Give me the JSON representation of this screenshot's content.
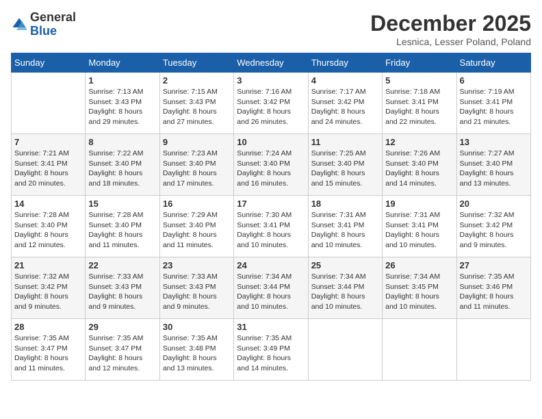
{
  "logo": {
    "general": "General",
    "blue": "Blue"
  },
  "header": {
    "month_title": "December 2025",
    "location": "Lesnica, Lesser Poland, Poland"
  },
  "days_of_week": [
    "Sunday",
    "Monday",
    "Tuesday",
    "Wednesday",
    "Thursday",
    "Friday",
    "Saturday"
  ],
  "weeks": [
    [
      {
        "day": "",
        "info": ""
      },
      {
        "day": "1",
        "info": "Sunrise: 7:13 AM\nSunset: 3:43 PM\nDaylight: 8 hours\nand 29 minutes."
      },
      {
        "day": "2",
        "info": "Sunrise: 7:15 AM\nSunset: 3:43 PM\nDaylight: 8 hours\nand 27 minutes."
      },
      {
        "day": "3",
        "info": "Sunrise: 7:16 AM\nSunset: 3:42 PM\nDaylight: 8 hours\nand 26 minutes."
      },
      {
        "day": "4",
        "info": "Sunrise: 7:17 AM\nSunset: 3:42 PM\nDaylight: 8 hours\nand 24 minutes."
      },
      {
        "day": "5",
        "info": "Sunrise: 7:18 AM\nSunset: 3:41 PM\nDaylight: 8 hours\nand 22 minutes."
      },
      {
        "day": "6",
        "info": "Sunrise: 7:19 AM\nSunset: 3:41 PM\nDaylight: 8 hours\nand 21 minutes."
      }
    ],
    [
      {
        "day": "7",
        "info": "Sunrise: 7:21 AM\nSunset: 3:41 PM\nDaylight: 8 hours\nand 20 minutes."
      },
      {
        "day": "8",
        "info": "Sunrise: 7:22 AM\nSunset: 3:40 PM\nDaylight: 8 hours\nand 18 minutes."
      },
      {
        "day": "9",
        "info": "Sunrise: 7:23 AM\nSunset: 3:40 PM\nDaylight: 8 hours\nand 17 minutes."
      },
      {
        "day": "10",
        "info": "Sunrise: 7:24 AM\nSunset: 3:40 PM\nDaylight: 8 hours\nand 16 minutes."
      },
      {
        "day": "11",
        "info": "Sunrise: 7:25 AM\nSunset: 3:40 PM\nDaylight: 8 hours\nand 15 minutes."
      },
      {
        "day": "12",
        "info": "Sunrise: 7:26 AM\nSunset: 3:40 PM\nDaylight: 8 hours\nand 14 minutes."
      },
      {
        "day": "13",
        "info": "Sunrise: 7:27 AM\nSunset: 3:40 PM\nDaylight: 8 hours\nand 13 minutes."
      }
    ],
    [
      {
        "day": "14",
        "info": "Sunrise: 7:28 AM\nSunset: 3:40 PM\nDaylight: 8 hours\nand 12 minutes."
      },
      {
        "day": "15",
        "info": "Sunrise: 7:28 AM\nSunset: 3:40 PM\nDaylight: 8 hours\nand 11 minutes."
      },
      {
        "day": "16",
        "info": "Sunrise: 7:29 AM\nSunset: 3:40 PM\nDaylight: 8 hours\nand 11 minutes."
      },
      {
        "day": "17",
        "info": "Sunrise: 7:30 AM\nSunset: 3:41 PM\nDaylight: 8 hours\nand 10 minutes."
      },
      {
        "day": "18",
        "info": "Sunrise: 7:31 AM\nSunset: 3:41 PM\nDaylight: 8 hours\nand 10 minutes."
      },
      {
        "day": "19",
        "info": "Sunrise: 7:31 AM\nSunset: 3:41 PM\nDaylight: 8 hours\nand 10 minutes."
      },
      {
        "day": "20",
        "info": "Sunrise: 7:32 AM\nSunset: 3:42 PM\nDaylight: 8 hours\nand 9 minutes."
      }
    ],
    [
      {
        "day": "21",
        "info": "Sunrise: 7:32 AM\nSunset: 3:42 PM\nDaylight: 8 hours\nand 9 minutes."
      },
      {
        "day": "22",
        "info": "Sunrise: 7:33 AM\nSunset: 3:43 PM\nDaylight: 8 hours\nand 9 minutes."
      },
      {
        "day": "23",
        "info": "Sunrise: 7:33 AM\nSunset: 3:43 PM\nDaylight: 8 hours\nand 9 minutes."
      },
      {
        "day": "24",
        "info": "Sunrise: 7:34 AM\nSunset: 3:44 PM\nDaylight: 8 hours\nand 10 minutes."
      },
      {
        "day": "25",
        "info": "Sunrise: 7:34 AM\nSunset: 3:44 PM\nDaylight: 8 hours\nand 10 minutes."
      },
      {
        "day": "26",
        "info": "Sunrise: 7:34 AM\nSunset: 3:45 PM\nDaylight: 8 hours\nand 10 minutes."
      },
      {
        "day": "27",
        "info": "Sunrise: 7:35 AM\nSunset: 3:46 PM\nDaylight: 8 hours\nand 11 minutes."
      }
    ],
    [
      {
        "day": "28",
        "info": "Sunrise: 7:35 AM\nSunset: 3:47 PM\nDaylight: 8 hours\nand 11 minutes."
      },
      {
        "day": "29",
        "info": "Sunrise: 7:35 AM\nSunset: 3:47 PM\nDaylight: 8 hours\nand 12 minutes."
      },
      {
        "day": "30",
        "info": "Sunrise: 7:35 AM\nSunset: 3:48 PM\nDaylight: 8 hours\nand 13 minutes."
      },
      {
        "day": "31",
        "info": "Sunrise: 7:35 AM\nSunset: 3:49 PM\nDaylight: 8 hours\nand 14 minutes."
      },
      {
        "day": "",
        "info": ""
      },
      {
        "day": "",
        "info": ""
      },
      {
        "day": "",
        "info": ""
      }
    ]
  ]
}
